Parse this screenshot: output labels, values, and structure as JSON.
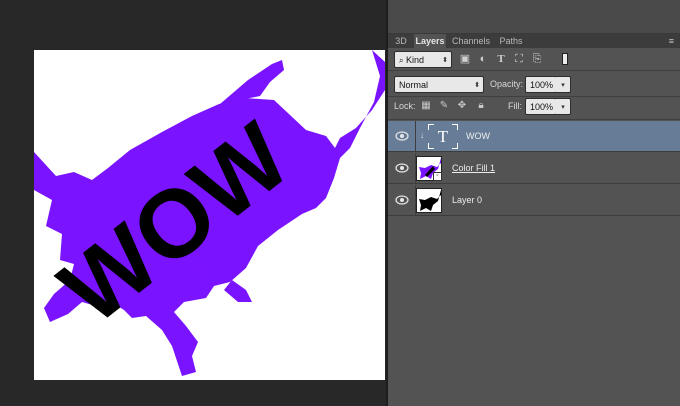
{
  "panel": {
    "tabs": [
      "3D",
      "Layers",
      "Channels",
      "Paths"
    ],
    "active_tab": "Layers",
    "filter_kind": "Kind",
    "blend_mode": "Normal",
    "opacity_label": "Opacity:",
    "opacity_value": "100%",
    "lock_label": "Lock:",
    "fill_label": "Fill:",
    "fill_value": "100%",
    "menu_icon": "panel-menu-icon"
  },
  "layers": [
    {
      "name": "WOW",
      "type": "text",
      "visible": true,
      "selected": true
    },
    {
      "name": "Color Fill 1",
      "type": "fill",
      "visible": true,
      "selected": false
    },
    {
      "name": "Layer 0",
      "type": "pixel",
      "visible": true,
      "selected": false
    }
  ],
  "canvas": {
    "artwork_text": "WOW",
    "fill_color": "#7a13ff",
    "text_color": "#000000",
    "background": "#ffffff"
  }
}
